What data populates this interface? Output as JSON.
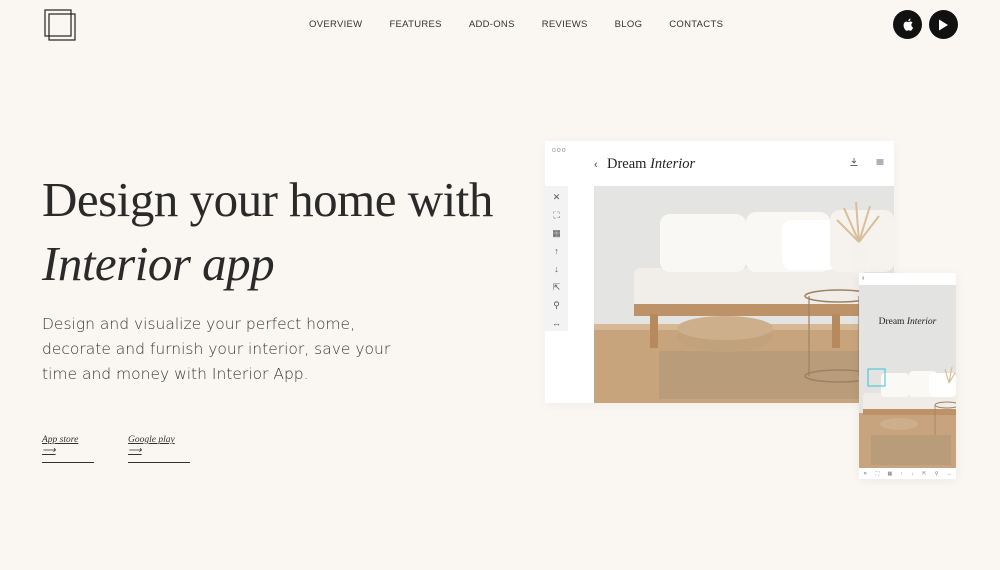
{
  "nav": {
    "items": [
      {
        "label": "OVERVIEW"
      },
      {
        "label": "FEATURES"
      },
      {
        "label": "ADD-ONS"
      },
      {
        "label": "REVIEWS"
      },
      {
        "label": "BLOG"
      },
      {
        "label": "CONTACTS"
      }
    ]
  },
  "hero": {
    "title_line1": "Design your home with",
    "title_line2": "Interior app",
    "description": "Design and visualize your perfect home, decorate and furnish your interior, save your time and money with Interior App.",
    "links": {
      "app_store": "App store ⟶",
      "google_play": "Google play ⟶"
    }
  },
  "mockup": {
    "dots": "ooo",
    "back": "‹",
    "title_plain": "Dream ",
    "title_italic": "Interior",
    "tools": [
      "✕",
      "⛶",
      "▦",
      "↑",
      "↓",
      "⇱",
      "⚲",
      "↔"
    ]
  },
  "phone": {
    "back": "‹",
    "title_plain": "Dream ",
    "title_italic": "Interior",
    "tools": [
      "✕",
      "⛶",
      "▦",
      "↑",
      "↓",
      "⇱",
      "⚲",
      "↔"
    ]
  },
  "colors": {
    "background": "#faf6f1",
    "text": "#2b2b2b",
    "button": "#111111"
  }
}
